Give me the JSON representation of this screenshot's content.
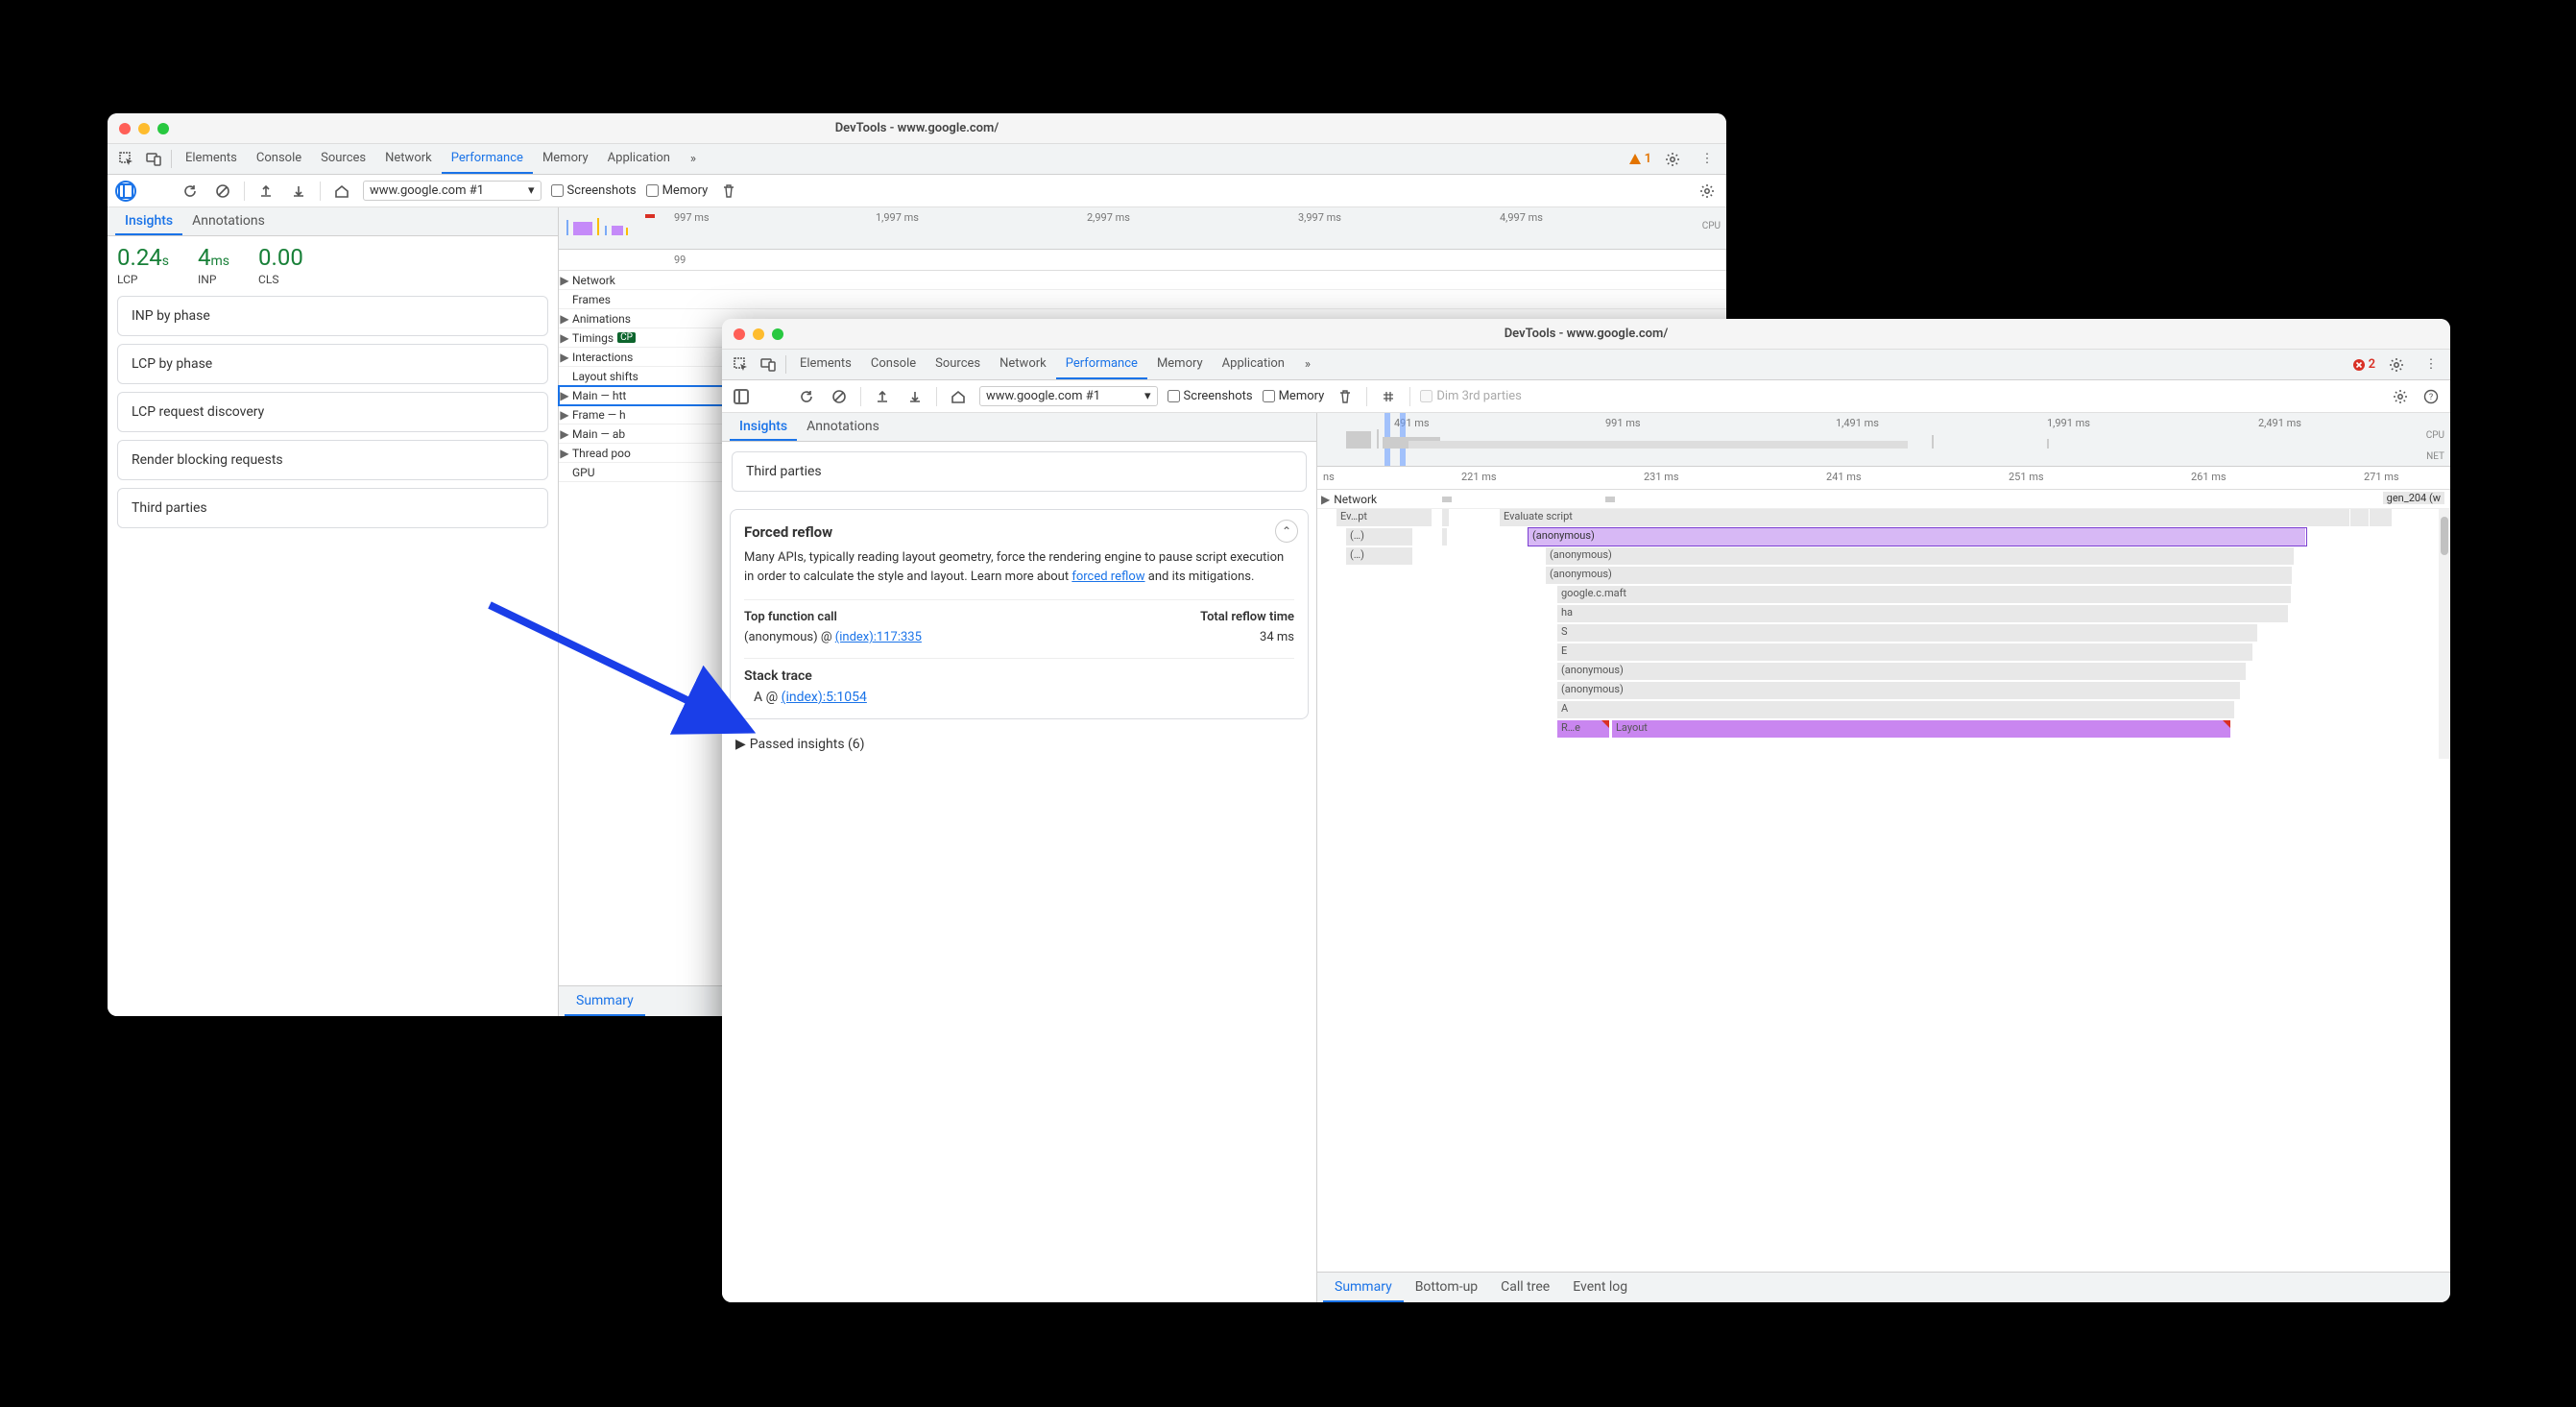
{
  "window1": {
    "title": "DevTools - www.google.com/",
    "tabs": [
      "Elements",
      "Console",
      "Sources",
      "Network",
      "Performance",
      "Memory",
      "Application"
    ],
    "active_tab": "Performance",
    "warning_count": "1",
    "page_select": "www.google.com #1",
    "checkbox_screenshots": "Screenshots",
    "checkbox_memory": "Memory",
    "insights_tabs": [
      "Insights",
      "Annotations"
    ],
    "insights_active": "Insights",
    "vitals": [
      {
        "value": "0.24",
        "unit": "s",
        "label": "LCP"
      },
      {
        "value": "4",
        "unit": "ms",
        "label": "INP"
      },
      {
        "value": "0.00",
        "unit": "",
        "label": "CLS"
      }
    ],
    "insight_cards": [
      "INP by phase",
      "LCP by phase",
      "LCP request discovery",
      "Render blocking requests",
      "Third parties"
    ],
    "ruler_ticks": [
      "997 ms",
      "1,997 ms",
      "2,997 ms",
      "3,997 ms",
      "4,997 ms"
    ],
    "cpu_label": "CPU",
    "ruler2_tick": "99",
    "tracks": [
      "Network",
      "Frames",
      "Animations",
      "Timings",
      "Interactions",
      "Layout shifts",
      "Main — htt",
      "Frame — h",
      "Main — ab",
      "Thread poo",
      "GPU"
    ],
    "timings_badge": "CP",
    "summary_tab": "Summary"
  },
  "window2": {
    "title": "DevTools - www.google.com/",
    "tabs": [
      "Elements",
      "Console",
      "Sources",
      "Network",
      "Performance",
      "Memory",
      "Application"
    ],
    "active_tab": "Performance",
    "error_count": "2",
    "page_select": "www.google.com #1",
    "checkbox_screenshots": "Screenshots",
    "checkbox_memory": "Memory",
    "dim3rd": "Dim 3rd parties",
    "insights_tabs": [
      "Insights",
      "Annotations"
    ],
    "insights_active": "Insights",
    "third_parties_card": "Third parties",
    "forced_reflow": {
      "title": "Forced reflow",
      "body_prefix": "Many APIs, typically reading layout geometry, force the rendering engine to pause script execution in order to calculate the style and layout. Learn more about ",
      "link_text": "forced reflow",
      "body_suffix": " and its mitigations.",
      "top_fn_hdr": "Top function call",
      "reflow_hdr": "Total reflow time",
      "top_fn_name": "(anonymous) @ ",
      "top_fn_link": "(index):117:335",
      "reflow_time": "34 ms",
      "stack_hdr": "Stack trace",
      "stack_name": "A @ ",
      "stack_link": "(index):5:1054"
    },
    "passed_insights": "Passed insights (6)",
    "ruler_ticks": [
      "491 ms",
      "991 ms",
      "1,491 ms",
      "1,991 ms",
      "2,491 ms"
    ],
    "cpu_label": "CPU",
    "net_label": "NET",
    "ruler2_ticks": [
      "ns",
      "221 ms",
      "231 ms",
      "241 ms",
      "251 ms",
      "261 ms",
      "271 ms"
    ],
    "net_track": "Network",
    "net_item": "gen_204 (w",
    "flame": {
      "evscript": "Ev…pt",
      "evaluate": "Evaluate script",
      "ellipsis": "(…)",
      "anon": "(anonymous)",
      "maft": "google.c.maft",
      "ha": "ha",
      "S": "S",
      "E": "E",
      "A": "A",
      "re": "R…e",
      "layout": "Layout"
    },
    "summary_tabs": [
      "Summary",
      "Bottom-up",
      "Call tree",
      "Event log"
    ],
    "summary_active": "Summary"
  }
}
